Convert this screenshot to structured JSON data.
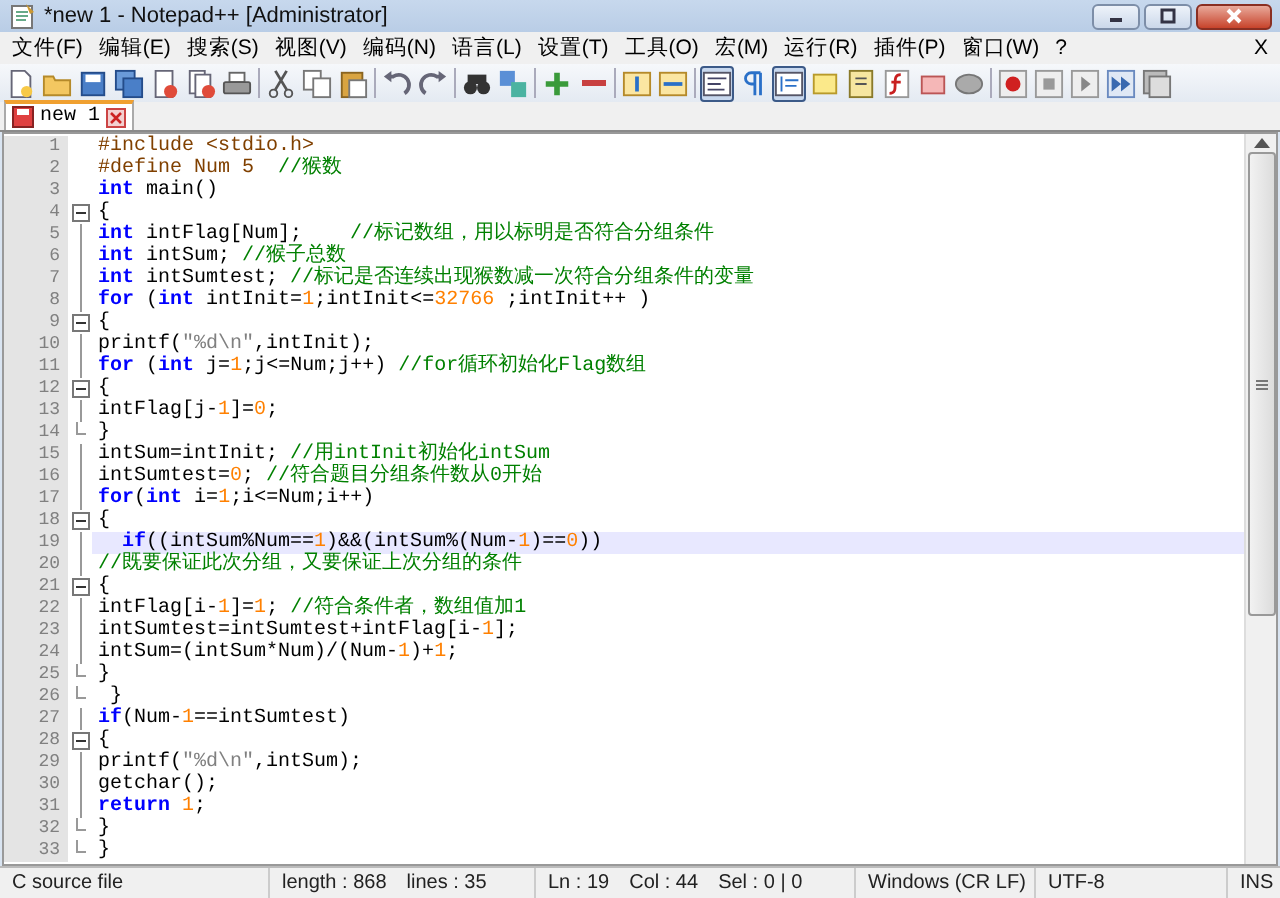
{
  "window": {
    "title": "*new 1 - Notepad++ [Administrator]"
  },
  "menu": {
    "items": [
      "文件(F)",
      "编辑(E)",
      "搜索(S)",
      "视图(V)",
      "编码(N)",
      "语言(L)",
      "设置(T)",
      "工具(O)",
      "宏(M)",
      "运行(R)",
      "插件(P)",
      "窗口(W)",
      "?"
    ],
    "close": "X"
  },
  "toolbar": [
    [
      {
        "kind": "new",
        "pressed": false
      },
      {
        "kind": "open",
        "pressed": false
      },
      {
        "kind": "save",
        "pressed": false
      },
      {
        "kind": "save-all",
        "pressed": false
      },
      {
        "kind": "close",
        "pressed": false
      },
      {
        "kind": "close-all",
        "pressed": false
      },
      {
        "kind": "print",
        "pressed": false
      }
    ],
    [
      {
        "kind": "cut",
        "pressed": false
      },
      {
        "kind": "copy",
        "pressed": false
      },
      {
        "kind": "paste",
        "pressed": false
      }
    ],
    [
      {
        "kind": "undo",
        "pressed": false
      },
      {
        "kind": "redo",
        "pressed": false
      }
    ],
    [
      {
        "kind": "find",
        "pressed": false
      },
      {
        "kind": "replace",
        "pressed": false
      }
    ],
    [
      {
        "kind": "zoom-in",
        "pressed": false
      },
      {
        "kind": "zoom-out",
        "pressed": false
      }
    ],
    [
      {
        "kind": "sync-v",
        "pressed": false
      },
      {
        "kind": "sync-h",
        "pressed": false
      }
    ],
    [
      {
        "kind": "wrap",
        "pressed": true
      },
      {
        "kind": "all-chars",
        "pressed": false
      },
      {
        "kind": "indent",
        "pressed": true
      },
      {
        "kind": "note",
        "pressed": false
      },
      {
        "kind": "doc",
        "pressed": false
      },
      {
        "kind": "function",
        "pressed": false
      },
      {
        "kind": "panel",
        "pressed": false
      },
      {
        "kind": "monitor",
        "pressed": false
      }
    ],
    [
      {
        "kind": "record",
        "pressed": false
      },
      {
        "kind": "stop",
        "pressed": false
      },
      {
        "kind": "play",
        "pressed": false
      },
      {
        "kind": "play-multi",
        "pressed": false
      },
      {
        "kind": "save-macro",
        "pressed": false
      }
    ]
  ],
  "tabs": [
    {
      "label": "new 1",
      "selected": true,
      "modified": true
    }
  ],
  "editor": {
    "lines": [
      {
        "number": "1",
        "fold_start": false,
        "fold_end": false,
        "current": false,
        "tokens": [
          {
            "kind": "pre",
            "text": "#include <stdio.h>"
          }
        ]
      },
      {
        "number": "2",
        "fold_start": false,
        "fold_end": false,
        "current": false,
        "tokens": [
          {
            "kind": "pre",
            "text": "#define Num 5  "
          },
          {
            "kind": "comment",
            "text": "//猴数"
          }
        ]
      },
      {
        "number": "3",
        "fold_start": false,
        "fold_end": false,
        "current": false,
        "tokens": [
          {
            "kind": "keyword",
            "text": "int"
          },
          {
            "kind": "text",
            "text": " main()"
          }
        ]
      },
      {
        "number": "4",
        "fold_start": true,
        "fold_end": false,
        "current": false,
        "tokens": [
          {
            "kind": "text",
            "text": "{"
          }
        ]
      },
      {
        "number": "5",
        "fold_start": false,
        "fold_end": false,
        "current": false,
        "tokens": [
          {
            "kind": "keyword",
            "text": "int"
          },
          {
            "kind": "text",
            "text": " intFlag[Num];    "
          },
          {
            "kind": "comment",
            "text": "//标记数组，用以标明是否符合分组条件"
          }
        ]
      },
      {
        "number": "6",
        "fold_start": false,
        "fold_end": false,
        "current": false,
        "tokens": [
          {
            "kind": "keyword",
            "text": "int"
          },
          {
            "kind": "text",
            "text": " intSum; "
          },
          {
            "kind": "comment",
            "text": "//猴子总数"
          }
        ]
      },
      {
        "number": "7",
        "fold_start": false,
        "fold_end": false,
        "current": false,
        "tokens": [
          {
            "kind": "keyword",
            "text": "int"
          },
          {
            "kind": "text",
            "text": " intSumtest; "
          },
          {
            "kind": "comment",
            "text": "//标记是否连续出现猴数减一次符合分组条件的变量"
          }
        ]
      },
      {
        "number": "8",
        "fold_start": false,
        "fold_end": false,
        "current": false,
        "tokens": [
          {
            "kind": "keyword",
            "text": "for"
          },
          {
            "kind": "text",
            "text": " ("
          },
          {
            "kind": "keyword",
            "text": "int"
          },
          {
            "kind": "text",
            "text": " intInit="
          },
          {
            "kind": "number",
            "text": "1"
          },
          {
            "kind": "text",
            "text": ";intInit<="
          },
          {
            "kind": "number",
            "text": "32766"
          },
          {
            "kind": "text",
            "text": " ;intInit++ )"
          }
        ]
      },
      {
        "number": "9",
        "fold_start": true,
        "fold_end": false,
        "current": false,
        "tokens": [
          {
            "kind": "text",
            "text": "{"
          }
        ]
      },
      {
        "number": "10",
        "fold_start": false,
        "fold_end": false,
        "current": false,
        "tokens": [
          {
            "kind": "text",
            "text": "printf("
          },
          {
            "kind": "string",
            "text": "\"%d\\n\""
          },
          {
            "kind": "text",
            "text": ",intInit);"
          }
        ]
      },
      {
        "number": "11",
        "fold_start": false,
        "fold_end": false,
        "current": false,
        "tokens": [
          {
            "kind": "keyword",
            "text": "for"
          },
          {
            "kind": "text",
            "text": " ("
          },
          {
            "kind": "keyword",
            "text": "int"
          },
          {
            "kind": "text",
            "text": " j="
          },
          {
            "kind": "number",
            "text": "1"
          },
          {
            "kind": "text",
            "text": ";j<=Num;j++) "
          },
          {
            "kind": "comment",
            "text": "//for循环初始化Flag数组"
          }
        ]
      },
      {
        "number": "12",
        "fold_start": true,
        "fold_end": false,
        "current": false,
        "tokens": [
          {
            "kind": "text",
            "text": "{"
          }
        ]
      },
      {
        "number": "13",
        "fold_start": false,
        "fold_end": false,
        "current": false,
        "tokens": [
          {
            "kind": "text",
            "text": "intFlag[j-"
          },
          {
            "kind": "number",
            "text": "1"
          },
          {
            "kind": "text",
            "text": "]="
          },
          {
            "kind": "number",
            "text": "0"
          },
          {
            "kind": "text",
            "text": ";"
          }
        ]
      },
      {
        "number": "14",
        "fold_start": false,
        "fold_end": true,
        "current": false,
        "tokens": [
          {
            "kind": "text",
            "text": "}"
          }
        ]
      },
      {
        "number": "15",
        "fold_start": false,
        "fold_end": false,
        "current": false,
        "tokens": [
          {
            "kind": "text",
            "text": "intSum=intInit; "
          },
          {
            "kind": "comment",
            "text": "//用intInit初始化intSum"
          }
        ]
      },
      {
        "number": "16",
        "fold_start": false,
        "fold_end": false,
        "current": false,
        "tokens": [
          {
            "kind": "text",
            "text": "intSumtest="
          },
          {
            "kind": "number",
            "text": "0"
          },
          {
            "kind": "text",
            "text": "; "
          },
          {
            "kind": "comment",
            "text": "//符合题目分组条件数从0开始"
          }
        ]
      },
      {
        "number": "17",
        "fold_start": false,
        "fold_end": false,
        "current": false,
        "tokens": [
          {
            "kind": "keyword",
            "text": "for"
          },
          {
            "kind": "text",
            "text": "("
          },
          {
            "kind": "keyword",
            "text": "int"
          },
          {
            "kind": "text",
            "text": " i="
          },
          {
            "kind": "number",
            "text": "1"
          },
          {
            "kind": "text",
            "text": ";i<=Num;i++)"
          }
        ]
      },
      {
        "number": "18",
        "fold_start": true,
        "fold_end": false,
        "current": false,
        "tokens": [
          {
            "kind": "text",
            "text": "{"
          }
        ]
      },
      {
        "number": "19",
        "fold_start": false,
        "fold_end": false,
        "current": true,
        "tokens": [
          {
            "kind": "keyword",
            "text": "  if"
          },
          {
            "kind": "text",
            "text": "((intSum%Num=="
          },
          {
            "kind": "number",
            "text": "1"
          },
          {
            "kind": "text",
            "text": ")&&(intSum%(Num-"
          },
          {
            "kind": "number",
            "text": "1"
          },
          {
            "kind": "text",
            "text": ")=="
          },
          {
            "kind": "number",
            "text": "0"
          },
          {
            "kind": "text",
            "text": "))"
          }
        ]
      },
      {
        "number": "20",
        "fold_start": false,
        "fold_end": false,
        "current": false,
        "tokens": [
          {
            "kind": "comment",
            "text": "//既要保证此次分组，又要保证上次分组的条件"
          }
        ]
      },
      {
        "number": "21",
        "fold_start": true,
        "fold_end": false,
        "current": false,
        "tokens": [
          {
            "kind": "text",
            "text": "{"
          }
        ]
      },
      {
        "number": "22",
        "fold_start": false,
        "fold_end": false,
        "current": false,
        "tokens": [
          {
            "kind": "text",
            "text": "intFlag[i-"
          },
          {
            "kind": "number",
            "text": "1"
          },
          {
            "kind": "text",
            "text": "]="
          },
          {
            "kind": "number",
            "text": "1"
          },
          {
            "kind": "text",
            "text": "; "
          },
          {
            "kind": "comment",
            "text": "//符合条件者，数组值加1"
          }
        ]
      },
      {
        "number": "23",
        "fold_start": false,
        "fold_end": false,
        "current": false,
        "tokens": [
          {
            "kind": "text",
            "text": "intSumtest=intSumtest+intFlag[i-"
          },
          {
            "kind": "number",
            "text": "1"
          },
          {
            "kind": "text",
            "text": "];"
          }
        ]
      },
      {
        "number": "24",
        "fold_start": false,
        "fold_end": false,
        "current": false,
        "tokens": [
          {
            "kind": "text",
            "text": "intSum=(intSum*Num)/(Num-"
          },
          {
            "kind": "number",
            "text": "1"
          },
          {
            "kind": "text",
            "text": ")+"
          },
          {
            "kind": "number",
            "text": "1"
          },
          {
            "kind": "text",
            "text": ";"
          }
        ]
      },
      {
        "number": "25",
        "fold_start": false,
        "fold_end": true,
        "current": false,
        "tokens": [
          {
            "kind": "text",
            "text": "}"
          }
        ]
      },
      {
        "number": "26",
        "fold_start": false,
        "fold_end": true,
        "current": false,
        "tokens": [
          {
            "kind": "text",
            "text": " }"
          }
        ]
      },
      {
        "number": "27",
        "fold_start": false,
        "fold_end": false,
        "current": false,
        "tokens": [
          {
            "kind": "keyword",
            "text": "if"
          },
          {
            "kind": "text",
            "text": "(Num-"
          },
          {
            "kind": "number",
            "text": "1"
          },
          {
            "kind": "text",
            "text": "==intSumtest)"
          }
        ]
      },
      {
        "number": "28",
        "fold_start": true,
        "fold_end": false,
        "current": false,
        "tokens": [
          {
            "kind": "text",
            "text": "{"
          }
        ]
      },
      {
        "number": "29",
        "fold_start": false,
        "fold_end": false,
        "current": false,
        "tokens": [
          {
            "kind": "text",
            "text": "printf("
          },
          {
            "kind": "string",
            "text": "\"%d\\n\""
          },
          {
            "kind": "text",
            "text": ",intSum);"
          }
        ]
      },
      {
        "number": "30",
        "fold_start": false,
        "fold_end": false,
        "current": false,
        "tokens": [
          {
            "kind": "text",
            "text": "getchar();"
          }
        ]
      },
      {
        "number": "31",
        "fold_start": false,
        "fold_end": false,
        "current": false,
        "tokens": [
          {
            "kind": "keyword",
            "text": "return "
          },
          {
            "kind": "number",
            "text": "1"
          },
          {
            "kind": "text",
            "text": ";"
          }
        ]
      },
      {
        "number": "32",
        "fold_start": false,
        "fold_end": true,
        "current": false,
        "tokens": [
          {
            "kind": "text",
            "text": "}"
          }
        ]
      },
      {
        "number": "33",
        "fold_start": false,
        "fold_end": true,
        "current": false,
        "tokens": [
          {
            "kind": "text",
            "text": "}"
          }
        ]
      }
    ]
  },
  "status_bar": [
    [
      "C source file"
    ],
    [
      "length : 868",
      "lines : 35"
    ],
    [
      "Ln : 19",
      "Col : 44",
      "Sel : 0 | 0"
    ],
    [
      "Windows (CR LF)"
    ],
    [
      "UTF-8"
    ],
    [
      "INS"
    ]
  ]
}
